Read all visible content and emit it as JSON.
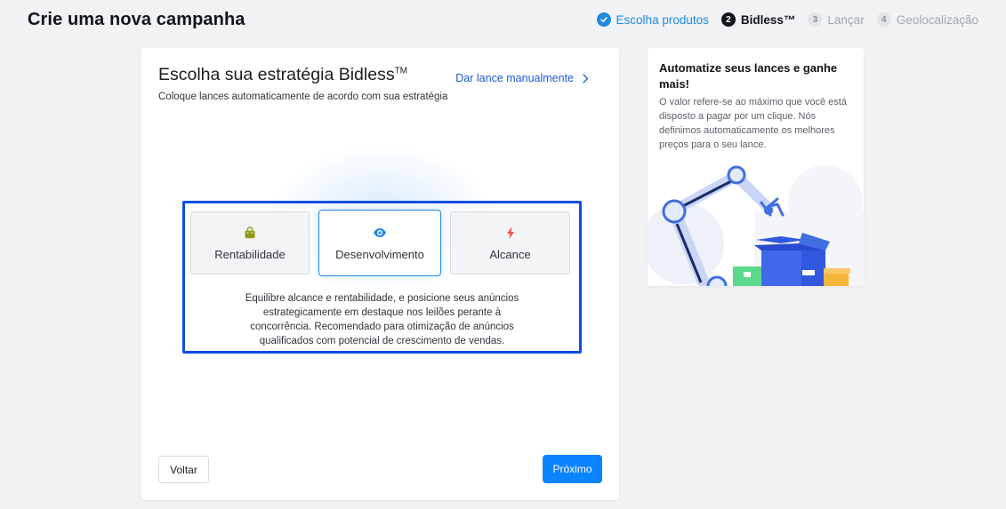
{
  "page": {
    "title": "Crie uma nova campanha"
  },
  "stepper": {
    "steps": [
      {
        "number": "",
        "label": "Escolha produtos",
        "state": "done"
      },
      {
        "number": "2",
        "label": "Bidless™",
        "state": "active"
      },
      {
        "number": "3",
        "label": "Lançar",
        "state": "todo"
      },
      {
        "number": "4",
        "label": "Geolocalização",
        "state": "todo"
      }
    ]
  },
  "main": {
    "title": "Escolha sua estratégia Bidless",
    "title_tm": "TM",
    "subtitle": "Coloque lances automaticamente de acordo com sua estratégia",
    "manual_link": "Dar lance manualmente",
    "options": [
      {
        "label": "Rentabilidade",
        "icon": "shopping-bag-icon",
        "color": "#8f9a1c"
      },
      {
        "label": "Desenvolvimento",
        "icon": "eye-icon",
        "color": "#1e88e5",
        "selected": true
      },
      {
        "label": "Alcance",
        "icon": "lightning-icon",
        "color": "#f04a4a"
      }
    ],
    "description": "Equilibre alcance e rentabilidade, e posicione seus anúncios estrategicamente em destaque nos leilões perante à concorrência. Recomendado para otimização de anúncios qualificados com potencial de crescimento de vendas.",
    "back_button": "Voltar",
    "next_button": "Próximo"
  },
  "side": {
    "title": "Automatize seus lances e ganhe mais!",
    "text": "O valor refere-se ao máximo que você está disposto a pagar por um clique. Nós definimos automaticamente os melhores preços para o seu lance."
  },
  "colors": {
    "primary": "#0a84ff",
    "highlight_border": "#0c4ee0",
    "link": "#1d5bd6"
  }
}
